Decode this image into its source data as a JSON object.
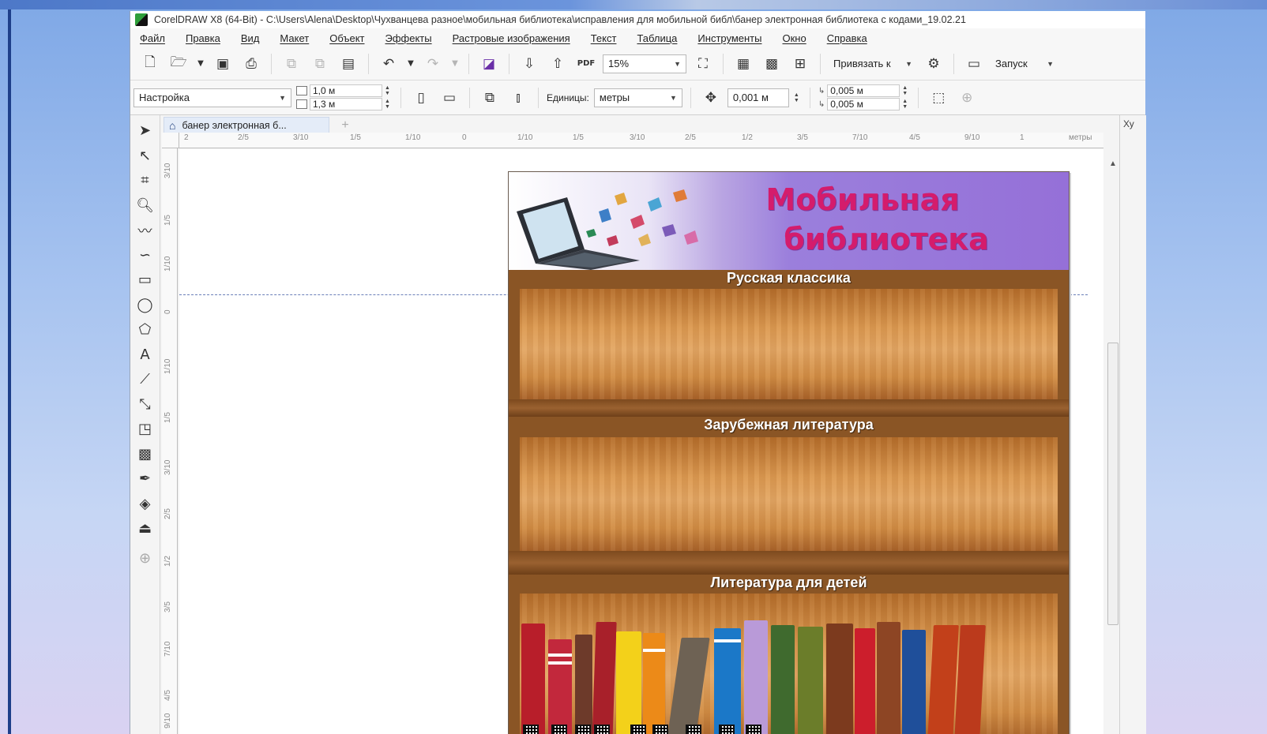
{
  "window": {
    "title": "CorelDRAW X8 (64-Bit) - C:\\Users\\Alena\\Desktop\\Чухванцева разное\\мобильная библиотека\\исправления для мобильной библ\\банер электронная библиотека с кодами_19.02.21"
  },
  "menu": [
    "Файл",
    "Правка",
    "Вид",
    "Макет",
    "Объект",
    "Эффекты",
    "Растровые изображения",
    "Текст",
    "Таблица",
    "Инструменты",
    "Окно",
    "Справка"
  ],
  "toolbar": {
    "zoom": "15%",
    "snap_label": "Привязать к",
    "launch_label": "Запуск"
  },
  "propbar": {
    "preset": "Настройка",
    "width": "1,0 м",
    "height": "1,3 м",
    "units_label": "Единицы:",
    "units_value": "метры",
    "nudge": "0,001 м",
    "dup_x": "0,005 м",
    "dup_y": "0,005 м"
  },
  "doc_tab": {
    "label": "банер электронная б..."
  },
  "ruler": {
    "h_labels": [
      "2",
      "2/5",
      "3/10",
      "1/5",
      "1/10",
      "0",
      "1/10",
      "1/5",
      "3/10",
      "2/5",
      "1/2",
      "3/5",
      "7/10",
      "4/5",
      "9/10",
      "1"
    ],
    "units": "метры",
    "v_labels": [
      "3/10",
      "1/5",
      "1/10",
      "0",
      "1/10",
      "1/5",
      "3/10",
      "2/5",
      "1/2",
      "3/5",
      "7/10",
      "4/5",
      "9/10"
    ]
  },
  "right_dock": {
    "label": "Ху"
  },
  "banner": {
    "title_line1": "Мобильная",
    "title_line2": "библиотека",
    "shelves": [
      {
        "label": "Русская классика"
      },
      {
        "label": "Зарубежная литература"
      },
      {
        "label": "Литература для детей"
      }
    ]
  },
  "colors": {
    "title": "#d41c6c",
    "banner_purple": "#9570d8",
    "wood": "#8a5525"
  }
}
